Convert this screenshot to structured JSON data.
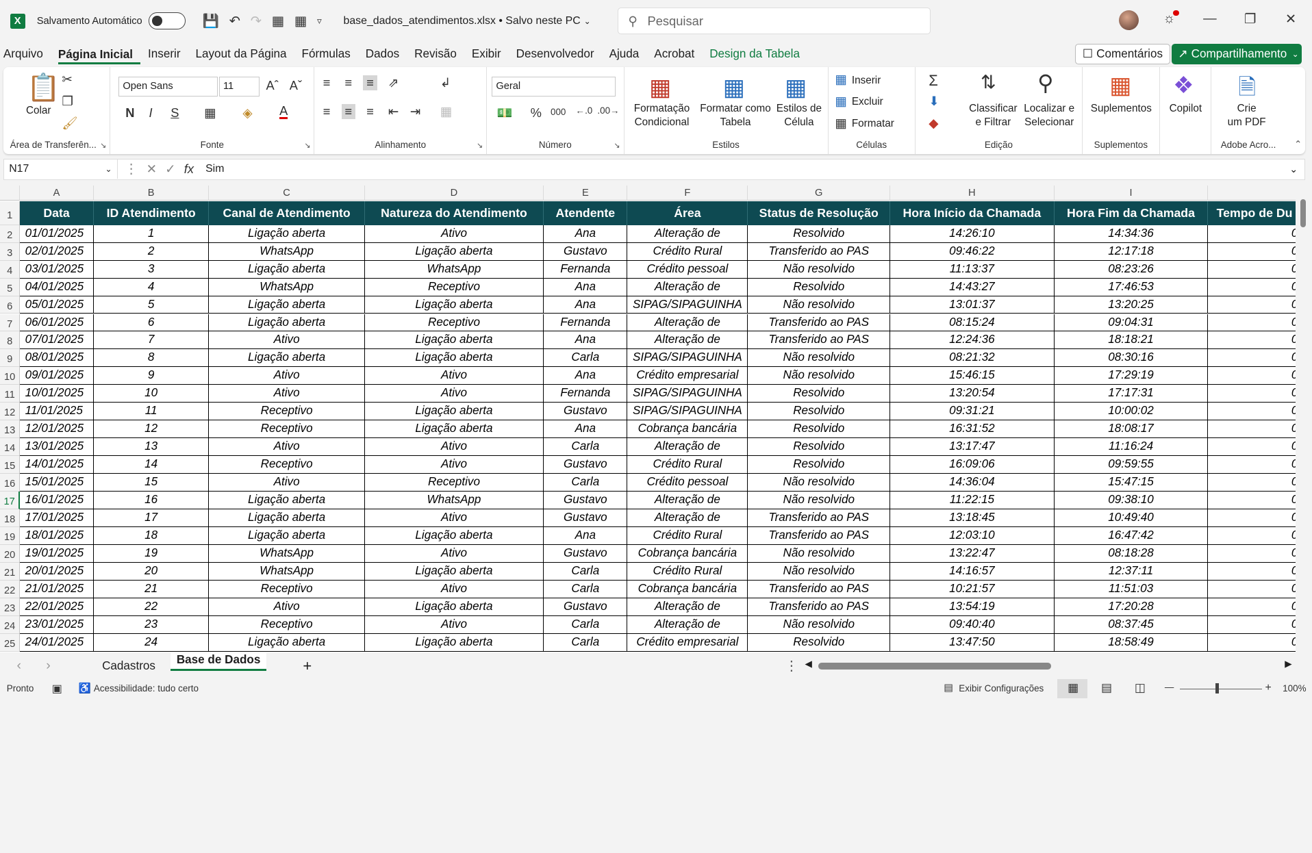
{
  "titlebar": {
    "autosave_label": "Salvamento Automático",
    "doc_title": "base_dados_atendimentos.xlsx • Salvo neste PC",
    "search_placeholder": "Pesquisar"
  },
  "tabs": [
    "Arquivo",
    "Página Inicial",
    "Inserir",
    "Layout da Página",
    "Fórmulas",
    "Dados",
    "Revisão",
    "Exibir",
    "Desenvolvedor",
    "Ajuda",
    "Acrobat",
    "Design da Tabela"
  ],
  "tabs_active": "Página Inicial",
  "buttons": {
    "comments": "Comentários",
    "share": "Compartilhamento"
  },
  "ribbon": {
    "clipboard": {
      "label": "Área de Transferên...",
      "paste": "Colar"
    },
    "font": {
      "label": "Fonte",
      "name": "Open Sans",
      "size": "11",
      "bold": "N",
      "italic": "I",
      "underline": "S"
    },
    "alignment": {
      "label": "Alinhamento"
    },
    "number": {
      "label": "Número",
      "format": "Geral"
    },
    "styles": {
      "label": "Estilos",
      "cond1": "Formatação",
      "cond2": "Condicional",
      "table1": "Formatar como",
      "table2": "Tabela",
      "cell1": "Estilos de",
      "cell2": "Célula"
    },
    "cells": {
      "label": "Células",
      "insert": "Inserir",
      "delete": "Excluir",
      "format": "Formatar"
    },
    "editing": {
      "label": "Edição",
      "sort1": "Classificar",
      "sort2": "e Filtrar",
      "find1": "Localizar e",
      "find2": "Selecionar"
    },
    "addins": {
      "label": "Suplementos",
      "btn": "Suplementos"
    },
    "copilot": {
      "btn": "Copilot"
    },
    "adobe": {
      "label": "Adobe Acro...",
      "btn1": "Crie",
      "btn2": "um PDF"
    }
  },
  "formula_bar": {
    "name_box": "N17",
    "content": "Sim"
  },
  "columns": [
    "A",
    "B",
    "C",
    "D",
    "E",
    "F",
    "G",
    "H",
    "I"
  ],
  "headers": [
    "Data",
    "ID Atendimento",
    "Canal de Atendimento",
    "Natureza do Atendimento",
    "Atendente",
    "Área",
    "Status de Resolução",
    "Hora Início da Chamada",
    "Hora Fim da Chamada",
    "Tempo de Du"
  ],
  "rows": [
    [
      "01/01/2025",
      "1",
      "Ligação aberta",
      "Ativo",
      "Ana",
      "Alteração de",
      "Resolvido",
      "14:26:10",
      "14:34:36"
    ],
    [
      "02/01/2025",
      "2",
      "WhatsApp",
      "Ligação aberta",
      "Gustavo",
      "Crédito Rural",
      "Transferido ao PAS",
      "09:46:22",
      "12:17:18"
    ],
    [
      "03/01/2025",
      "3",
      "Ligação aberta",
      "WhatsApp",
      "Fernanda",
      "Crédito pessoal",
      "Não resolvido",
      "11:13:37",
      "08:23:26"
    ],
    [
      "04/01/2025",
      "4",
      "WhatsApp",
      "Receptivo",
      "Ana",
      "Alteração de",
      "Resolvido",
      "14:43:27",
      "17:46:53"
    ],
    [
      "05/01/2025",
      "5",
      "Ligação aberta",
      "Ligação aberta",
      "Ana",
      "SIPAG/SIPAGUINHA",
      "Não resolvido",
      "13:01:37",
      "13:20:25"
    ],
    [
      "06/01/2025",
      "6",
      "Ligação aberta",
      "Receptivo",
      "Fernanda",
      "Alteração de",
      "Transferido ao PAS",
      "08:15:24",
      "09:04:31"
    ],
    [
      "07/01/2025",
      "7",
      "Ativo",
      "Ligação aberta",
      "Ana",
      "Alteração de",
      "Transferido ao PAS",
      "12:24:36",
      "18:18:21"
    ],
    [
      "08/01/2025",
      "8",
      "Ligação aberta",
      "Ligação aberta",
      "Carla",
      "SIPAG/SIPAGUINHA",
      "Não resolvido",
      "08:21:32",
      "08:30:16"
    ],
    [
      "09/01/2025",
      "9",
      "Ativo",
      "Ativo",
      "Ana",
      "Crédito empresarial",
      "Não resolvido",
      "15:46:15",
      "17:29:19"
    ],
    [
      "10/01/2025",
      "10",
      "Ativo",
      "Ativo",
      "Fernanda",
      "SIPAG/SIPAGUINHA",
      "Resolvido",
      "13:20:54",
      "17:17:31"
    ],
    [
      "11/01/2025",
      "11",
      "Receptivo",
      "Ligação aberta",
      "Gustavo",
      "SIPAG/SIPAGUINHA",
      "Resolvido",
      "09:31:21",
      "10:00:02"
    ],
    [
      "12/01/2025",
      "12",
      "Receptivo",
      "Ligação aberta",
      "Ana",
      "Cobrança bancária",
      "Resolvido",
      "16:31:52",
      "18:08:17"
    ],
    [
      "13/01/2025",
      "13",
      "Ativo",
      "Ativo",
      "Carla",
      "Alteração de",
      "Resolvido",
      "13:17:47",
      "11:16:24"
    ],
    [
      "14/01/2025",
      "14",
      "Receptivo",
      "Ativo",
      "Gustavo",
      "Crédito Rural",
      "Resolvido",
      "16:09:06",
      "09:59:55"
    ],
    [
      "15/01/2025",
      "15",
      "Ativo",
      "Receptivo",
      "Carla",
      "Crédito pessoal",
      "Não resolvido",
      "14:36:04",
      "15:47:15"
    ],
    [
      "16/01/2025",
      "16",
      "Ligação aberta",
      "WhatsApp",
      "Gustavo",
      "Alteração de",
      "Não resolvido",
      "11:22:15",
      "09:38:10"
    ],
    [
      "17/01/2025",
      "17",
      "Ligação aberta",
      "Ativo",
      "Gustavo",
      "Alteração de",
      "Transferido ao PAS",
      "13:18:45",
      "10:49:40"
    ],
    [
      "18/01/2025",
      "18",
      "Ligação aberta",
      "Ligação aberta",
      "Ana",
      "Crédito Rural",
      "Transferido ao PAS",
      "12:03:10",
      "16:47:42"
    ],
    [
      "19/01/2025",
      "19",
      "WhatsApp",
      "Ativo",
      "Gustavo",
      "Cobrança bancária",
      "Não resolvido",
      "13:22:47",
      "08:18:28"
    ],
    [
      "20/01/2025",
      "20",
      "WhatsApp",
      "Ligação aberta",
      "Carla",
      "Crédito Rural",
      "Não resolvido",
      "14:16:57",
      "12:37:11"
    ],
    [
      "21/01/2025",
      "21",
      "Receptivo",
      "Ativo",
      "Carla",
      "Cobrança bancária",
      "Transferido ao PAS",
      "10:21:57",
      "11:51:03"
    ],
    [
      "22/01/2025",
      "22",
      "Ativo",
      "Ligação aberta",
      "Gustavo",
      "Alteração de",
      "Transferido ao PAS",
      "13:54:19",
      "17:20:28"
    ],
    [
      "23/01/2025",
      "23",
      "Receptivo",
      "Ativo",
      "Carla",
      "Alteração de",
      "Não resolvido",
      "09:40:40",
      "08:37:45"
    ],
    [
      "24/01/2025",
      "24",
      "Ligação aberta",
      "Ligação aberta",
      "Carla",
      "Crédito empresarial",
      "Resolvido",
      "13:47:50",
      "18:58:49"
    ]
  ],
  "sheets": [
    "Cadastros",
    "Base de Dados"
  ],
  "sheet_active": "Base de Dados",
  "status": {
    "ready": "Pronto",
    "accessibility": "Acessibilidade: tudo certo",
    "display_settings": "Exibir Configurações",
    "zoom": "100%"
  },
  "colors": {
    "excel_green": "#107c41",
    "header_fill": "#0e4a52"
  }
}
